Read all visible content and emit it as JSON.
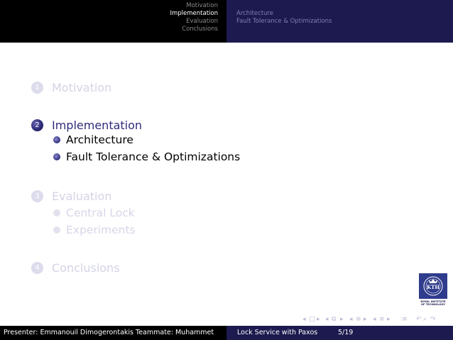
{
  "header": {
    "sections": [
      "Motivation",
      "Implementation",
      "Evaluation",
      "Conclusions"
    ],
    "active_section": "Implementation",
    "subsections": [
      "Architecture",
      "Fault Tolerance & Optimizations"
    ]
  },
  "toc": {
    "sections": [
      {
        "number": "1",
        "title": "Motivation",
        "active": false,
        "subsections": []
      },
      {
        "number": "2",
        "title": "Implementation",
        "active": true,
        "subsections": [
          "Architecture",
          "Fault Tolerance & Optimizations"
        ]
      },
      {
        "number": "3",
        "title": "Evaluation",
        "active": false,
        "subsections": [
          "Central Lock",
          "Experiments"
        ]
      },
      {
        "number": "4",
        "title": "Conclusions",
        "active": false,
        "subsections": []
      }
    ]
  },
  "logo": {
    "name": "KTH",
    "caption_lines": [
      "ROYAL INSTITUTE",
      "OF TECHNOLOGY"
    ]
  },
  "footer": {
    "presenter": "Presenter: Emmanouil Dimogerontakis Teammate: Muhammet",
    "title": "Lock Service with Paxos",
    "page": "5/19"
  },
  "nav_icons": [
    "nav-left-arrow-icon",
    "slide-icon",
    "nav-right-arrow-icon",
    "frame-icon",
    "section-icon",
    "subsection-icon",
    "align-icon",
    "search-icon"
  ],
  "colors": {
    "header_left": "#000000",
    "header_right": "#1c1a4e",
    "accent": "#2f2c7a",
    "faded": "#d3d3e6"
  }
}
